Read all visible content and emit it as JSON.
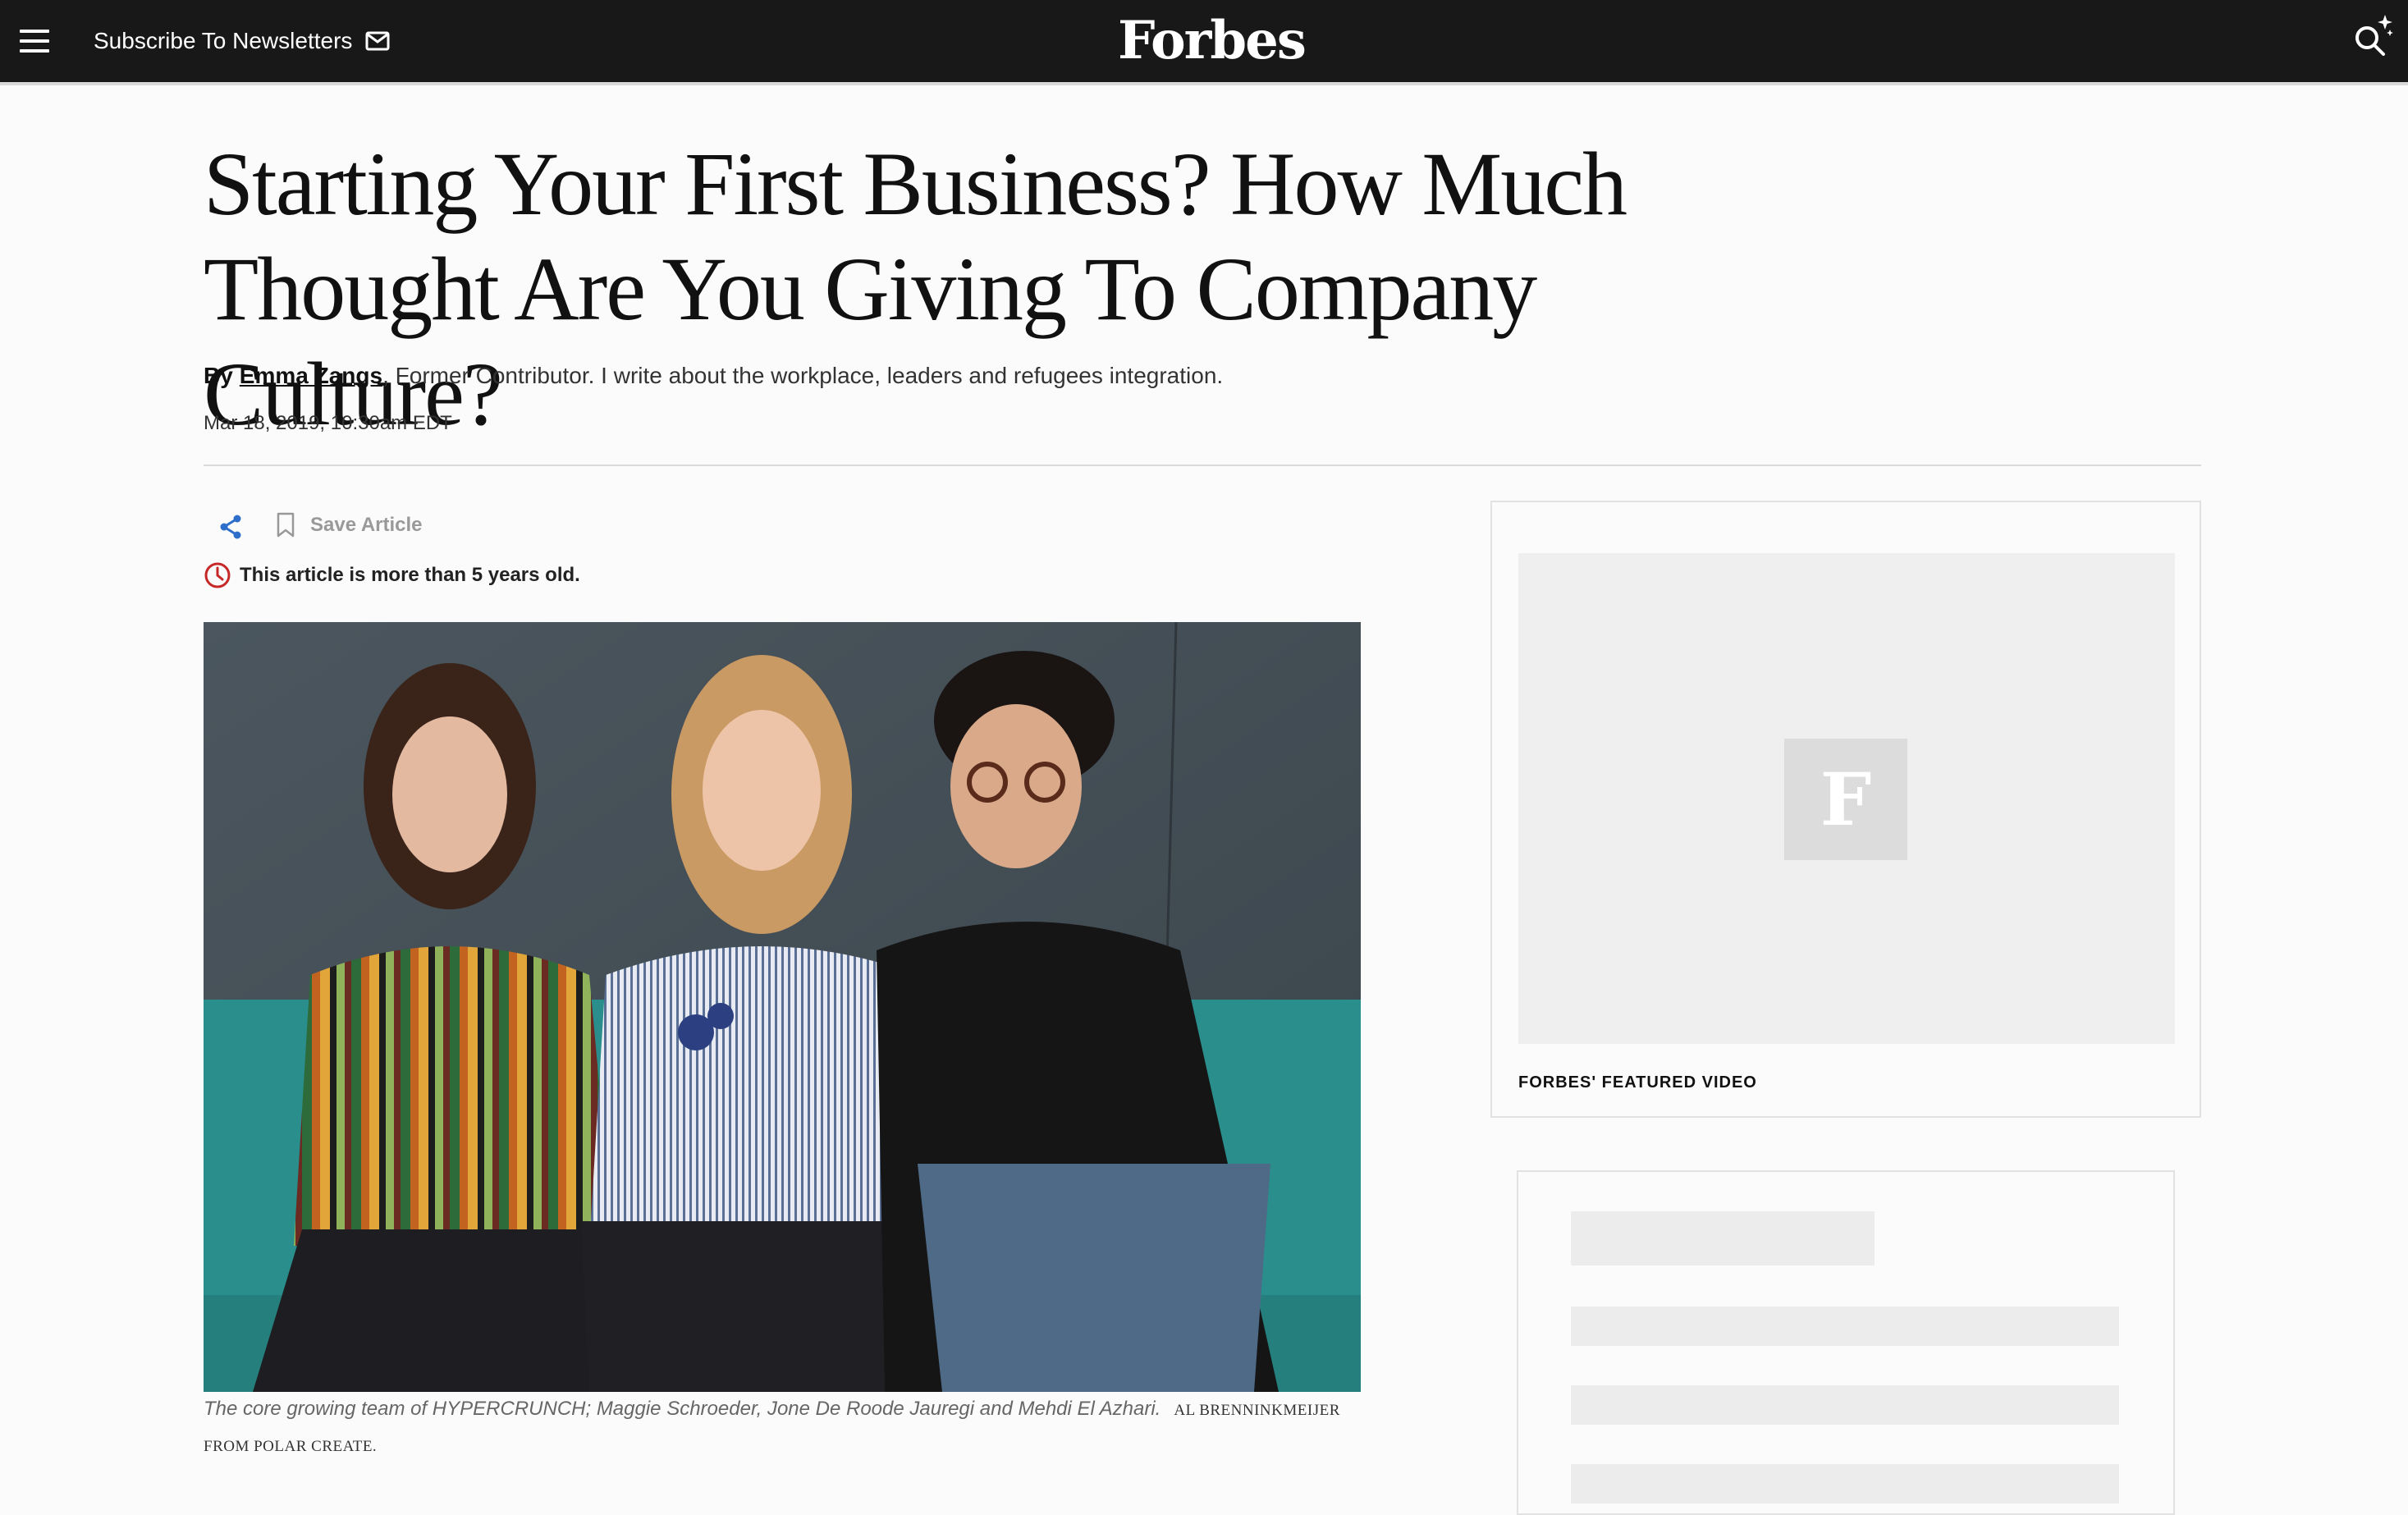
{
  "header": {
    "subscribe_label": "Subscribe To Newsletters",
    "logo_text": "Forbes",
    "background_color": "#181818"
  },
  "article": {
    "title": "Starting Your First Business? How Much Thought Are You Giving To Company Culture?",
    "by_label": "By",
    "author": "Emma Zangs",
    "author_bio": ", Former Contributor. I write about the workplace, leaders and refugees integration.",
    "date": "Mar 18, 2019, 10:30am EDT",
    "save_label": "Save Article",
    "age_notice": "This article is more than 5 years old.",
    "caption": "The core growing team of HYPERCRUNCH; Maggie Schroeder, Jone De Roode Jauregi and Mehdi El Azhari.",
    "photo_credit": "AL BRENNINKMEIJER FROM POLAR CREATE."
  },
  "sidebar": {
    "video_logo": "F",
    "video_label": "FORBES' FEATURED VIDEO"
  },
  "colors": {
    "accent_blue": "#2e6ecb",
    "alert_red": "#c62828"
  },
  "icons": [
    "menu-icon",
    "mail-icon",
    "search-sparkle-icon",
    "share-icon",
    "bookmark-icon",
    "clock-alert-icon"
  ]
}
